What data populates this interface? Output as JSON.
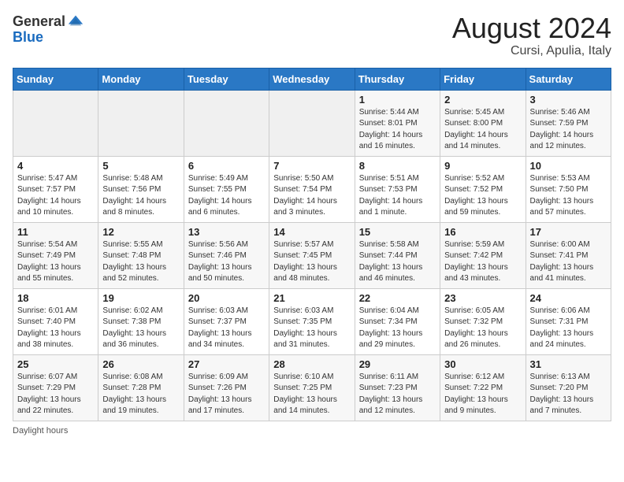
{
  "logo": {
    "general": "General",
    "blue": "Blue"
  },
  "title": {
    "month_year": "August 2024",
    "location": "Cursi, Apulia, Italy"
  },
  "days_header": [
    "Sunday",
    "Monday",
    "Tuesday",
    "Wednesday",
    "Thursday",
    "Friday",
    "Saturday"
  ],
  "footer_label": "Daylight hours",
  "weeks": [
    [
      {
        "day": "",
        "info": ""
      },
      {
        "day": "",
        "info": ""
      },
      {
        "day": "",
        "info": ""
      },
      {
        "day": "",
        "info": ""
      },
      {
        "day": "1",
        "info": "Sunrise: 5:44 AM\nSunset: 8:01 PM\nDaylight: 14 hours\nand 16 minutes."
      },
      {
        "day": "2",
        "info": "Sunrise: 5:45 AM\nSunset: 8:00 PM\nDaylight: 14 hours\nand 14 minutes."
      },
      {
        "day": "3",
        "info": "Sunrise: 5:46 AM\nSunset: 7:59 PM\nDaylight: 14 hours\nand 12 minutes."
      }
    ],
    [
      {
        "day": "4",
        "info": "Sunrise: 5:47 AM\nSunset: 7:57 PM\nDaylight: 14 hours\nand 10 minutes."
      },
      {
        "day": "5",
        "info": "Sunrise: 5:48 AM\nSunset: 7:56 PM\nDaylight: 14 hours\nand 8 minutes."
      },
      {
        "day": "6",
        "info": "Sunrise: 5:49 AM\nSunset: 7:55 PM\nDaylight: 14 hours\nand 6 minutes."
      },
      {
        "day": "7",
        "info": "Sunrise: 5:50 AM\nSunset: 7:54 PM\nDaylight: 14 hours\nand 3 minutes."
      },
      {
        "day": "8",
        "info": "Sunrise: 5:51 AM\nSunset: 7:53 PM\nDaylight: 14 hours\nand 1 minute."
      },
      {
        "day": "9",
        "info": "Sunrise: 5:52 AM\nSunset: 7:52 PM\nDaylight: 13 hours\nand 59 minutes."
      },
      {
        "day": "10",
        "info": "Sunrise: 5:53 AM\nSunset: 7:50 PM\nDaylight: 13 hours\nand 57 minutes."
      }
    ],
    [
      {
        "day": "11",
        "info": "Sunrise: 5:54 AM\nSunset: 7:49 PM\nDaylight: 13 hours\nand 55 minutes."
      },
      {
        "day": "12",
        "info": "Sunrise: 5:55 AM\nSunset: 7:48 PM\nDaylight: 13 hours\nand 52 minutes."
      },
      {
        "day": "13",
        "info": "Sunrise: 5:56 AM\nSunset: 7:46 PM\nDaylight: 13 hours\nand 50 minutes."
      },
      {
        "day": "14",
        "info": "Sunrise: 5:57 AM\nSunset: 7:45 PM\nDaylight: 13 hours\nand 48 minutes."
      },
      {
        "day": "15",
        "info": "Sunrise: 5:58 AM\nSunset: 7:44 PM\nDaylight: 13 hours\nand 46 minutes."
      },
      {
        "day": "16",
        "info": "Sunrise: 5:59 AM\nSunset: 7:42 PM\nDaylight: 13 hours\nand 43 minutes."
      },
      {
        "day": "17",
        "info": "Sunrise: 6:00 AM\nSunset: 7:41 PM\nDaylight: 13 hours\nand 41 minutes."
      }
    ],
    [
      {
        "day": "18",
        "info": "Sunrise: 6:01 AM\nSunset: 7:40 PM\nDaylight: 13 hours\nand 38 minutes."
      },
      {
        "day": "19",
        "info": "Sunrise: 6:02 AM\nSunset: 7:38 PM\nDaylight: 13 hours\nand 36 minutes."
      },
      {
        "day": "20",
        "info": "Sunrise: 6:03 AM\nSunset: 7:37 PM\nDaylight: 13 hours\nand 34 minutes."
      },
      {
        "day": "21",
        "info": "Sunrise: 6:03 AM\nSunset: 7:35 PM\nDaylight: 13 hours\nand 31 minutes."
      },
      {
        "day": "22",
        "info": "Sunrise: 6:04 AM\nSunset: 7:34 PM\nDaylight: 13 hours\nand 29 minutes."
      },
      {
        "day": "23",
        "info": "Sunrise: 6:05 AM\nSunset: 7:32 PM\nDaylight: 13 hours\nand 26 minutes."
      },
      {
        "day": "24",
        "info": "Sunrise: 6:06 AM\nSunset: 7:31 PM\nDaylight: 13 hours\nand 24 minutes."
      }
    ],
    [
      {
        "day": "25",
        "info": "Sunrise: 6:07 AM\nSunset: 7:29 PM\nDaylight: 13 hours\nand 22 minutes."
      },
      {
        "day": "26",
        "info": "Sunrise: 6:08 AM\nSunset: 7:28 PM\nDaylight: 13 hours\nand 19 minutes."
      },
      {
        "day": "27",
        "info": "Sunrise: 6:09 AM\nSunset: 7:26 PM\nDaylight: 13 hours\nand 17 minutes."
      },
      {
        "day": "28",
        "info": "Sunrise: 6:10 AM\nSunset: 7:25 PM\nDaylight: 13 hours\nand 14 minutes."
      },
      {
        "day": "29",
        "info": "Sunrise: 6:11 AM\nSunset: 7:23 PM\nDaylight: 13 hours\nand 12 minutes."
      },
      {
        "day": "30",
        "info": "Sunrise: 6:12 AM\nSunset: 7:22 PM\nDaylight: 13 hours\nand 9 minutes."
      },
      {
        "day": "31",
        "info": "Sunrise: 6:13 AM\nSunset: 7:20 PM\nDaylight: 13 hours\nand 7 minutes."
      }
    ]
  ]
}
